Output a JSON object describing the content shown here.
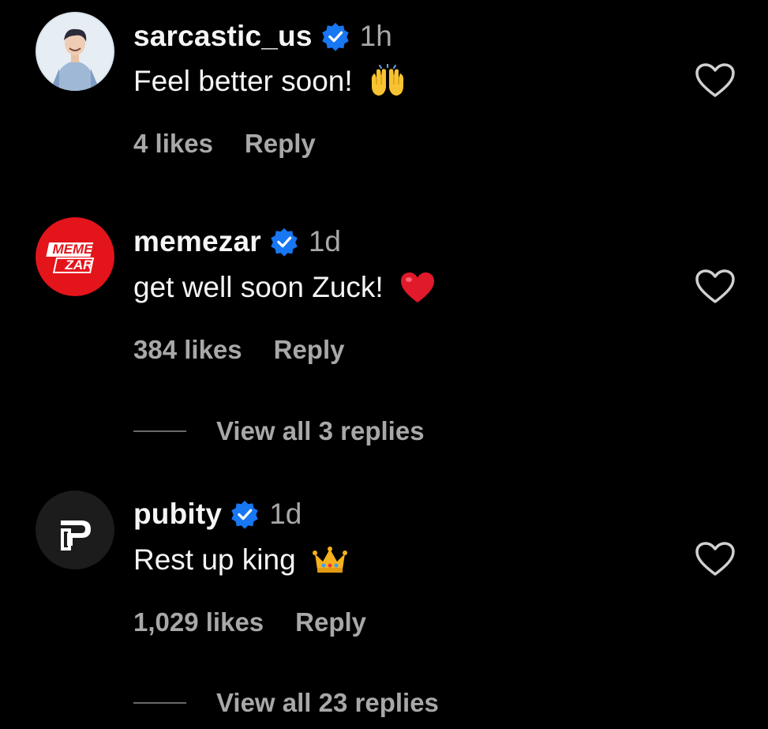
{
  "colors": {
    "background": "#000000",
    "primary_text": "#f5f5f5",
    "secondary_text": "#a8a8a8",
    "verified": "#1877f2",
    "memezar_red": "#e4141b"
  },
  "comments": [
    {
      "username": "sarcastic_us",
      "verified": true,
      "time": "1h",
      "text": "Feel better soon!",
      "emoji": "raising-hands",
      "likes": "4 likes",
      "reply_label": "Reply"
    },
    {
      "username": "memezar",
      "verified": true,
      "time": "1d",
      "text": "get well soon Zuck!",
      "emoji": "red-heart",
      "likes": "384 likes",
      "reply_label": "Reply",
      "view_replies": "View all 3 replies",
      "avatar_text_top": "MEME",
      "avatar_text_bottom": "ZAR"
    },
    {
      "username": "pubity",
      "verified": true,
      "time": "1d",
      "text": "Rest up king",
      "emoji": "crown",
      "likes": "1,029 likes",
      "reply_label": "Reply",
      "view_replies": "View all 23 replies"
    }
  ]
}
